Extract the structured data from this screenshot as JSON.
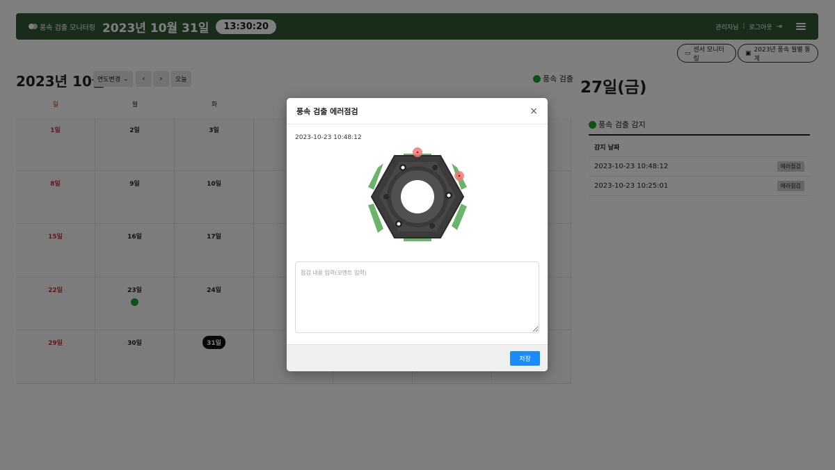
{
  "header": {
    "brand": "풍속 검출 모니터링",
    "date": "2023년 10월 31일",
    "clock": "13:30:20",
    "user": "관리자님",
    "separator": "|",
    "logout": "로그아웃"
  },
  "toolbar": {
    "sensor_monitoring": "센서 모니터링",
    "monthly_stats": "2023년 풍속 월별 통계"
  },
  "calendar": {
    "title": "2023년 10월",
    "year_select": "연도변경",
    "prev": "‹",
    "next": "›",
    "today": "오늘",
    "legend": "풍속 검출",
    "weekdays": [
      "일",
      "월",
      "화",
      "",
      "",
      "",
      ""
    ],
    "weeks": [
      [
        "1일",
        "2일",
        "3일",
        "",
        "",
        "",
        ""
      ],
      [
        "8일",
        "9일",
        "10일",
        "",
        "",
        "",
        ""
      ],
      [
        "15일",
        "16일",
        "17일",
        "",
        "",
        "",
        ""
      ],
      [
        "22일",
        "23일",
        "24일",
        "",
        "",
        "",
        ""
      ],
      [
        "29일",
        "30일",
        "31일",
        "",
        "",
        "",
        ""
      ]
    ],
    "event_days": [
      "23일"
    ],
    "today_day": "31일"
  },
  "detail": {
    "day_title": "27일(금)",
    "panel_title": "풍속 검출 감지",
    "column": "감지 날짜",
    "rows": [
      {
        "time": "2023-10-23 10:48:12",
        "badge": "에러점검"
      },
      {
        "time": "2023-10-23 10:25:01",
        "badge": "에러점검"
      }
    ]
  },
  "modal": {
    "title": "풍속 검출 에러점검",
    "close": "×",
    "timestamp": "2023-10-23 10:48:12",
    "comment_placeholder": "점검 내용 입력(코멘트 입력)",
    "comment_value": "",
    "save": "저장"
  },
  "colors": {
    "header_bg": "#2f5a34",
    "event_dot": "#17a52b",
    "save_button": "#1a8cff",
    "sunday": "#d02a2a"
  }
}
